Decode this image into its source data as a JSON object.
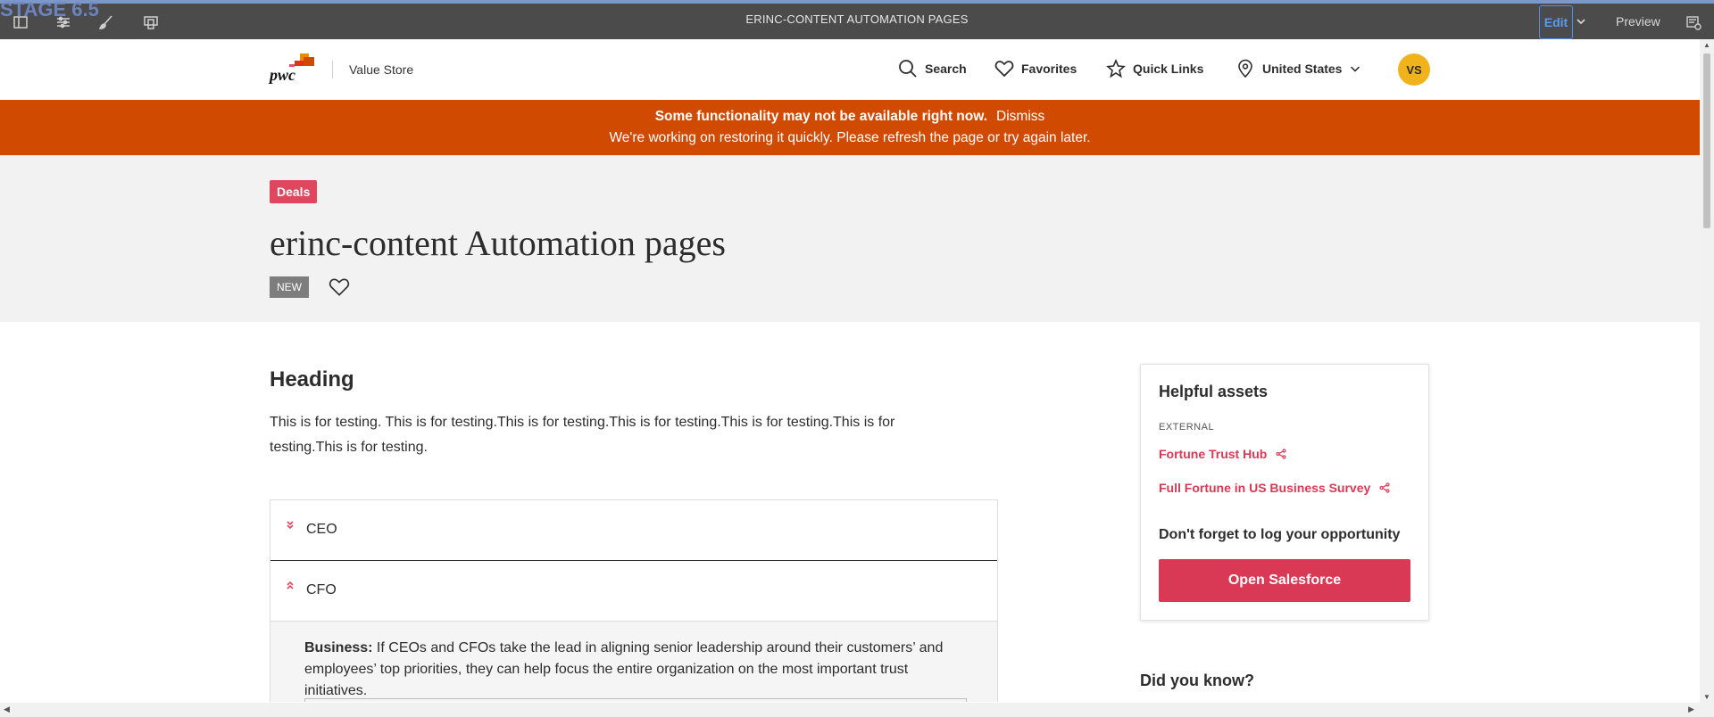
{
  "editor": {
    "stage_label": "STAGE 6.5",
    "page_title": "ERINC-CONTENT AUTOMATION PAGES",
    "edit_label": "Edit",
    "preview_label": "Preview"
  },
  "header": {
    "logo_text": "pwc",
    "store_name": "Value Store",
    "nav": {
      "search": "Search",
      "favorites": "Favorites",
      "quick_links": "Quick Links",
      "region": "United States"
    },
    "avatar_initials": "VS"
  },
  "alert": {
    "headline": "Some functionality may not be available right now.",
    "dismiss": "Dismiss",
    "message": "We're working on restoring it quickly. Please refresh the page or try again later."
  },
  "hero": {
    "tag": "Deals",
    "title": "erinc-content Automation pages",
    "badge": "NEW"
  },
  "main": {
    "heading": "Heading",
    "text": "This is for testing. This is for testing.This is for testing.This is for testing.This is for testing.This is for testing.This is for testing.",
    "accordion": [
      {
        "label": "CEO"
      },
      {
        "label": "CFO"
      }
    ],
    "cfo_body_label": "Business:",
    "cfo_body_text": "If CEOs and CFOs take the lead in aligning senior leadership around their customers’ and employees’ top priorities, they can help focus the entire organization on the most important trust initiatives."
  },
  "sidebar": {
    "title": "Helpful assets",
    "category": "EXTERNAL",
    "links": [
      "Fortune Trust Hub",
      "Full Fortune in US Business Survey"
    ],
    "opportunity_text": "Don't forget to log your opportunity",
    "button": "Open Salesforce",
    "did_you_know": "Did you know?"
  },
  "colors": {
    "toolbar": "#4b4b4b",
    "alert": "#d04a02",
    "accent": "#d93954",
    "avatar": "#f1b31c"
  }
}
